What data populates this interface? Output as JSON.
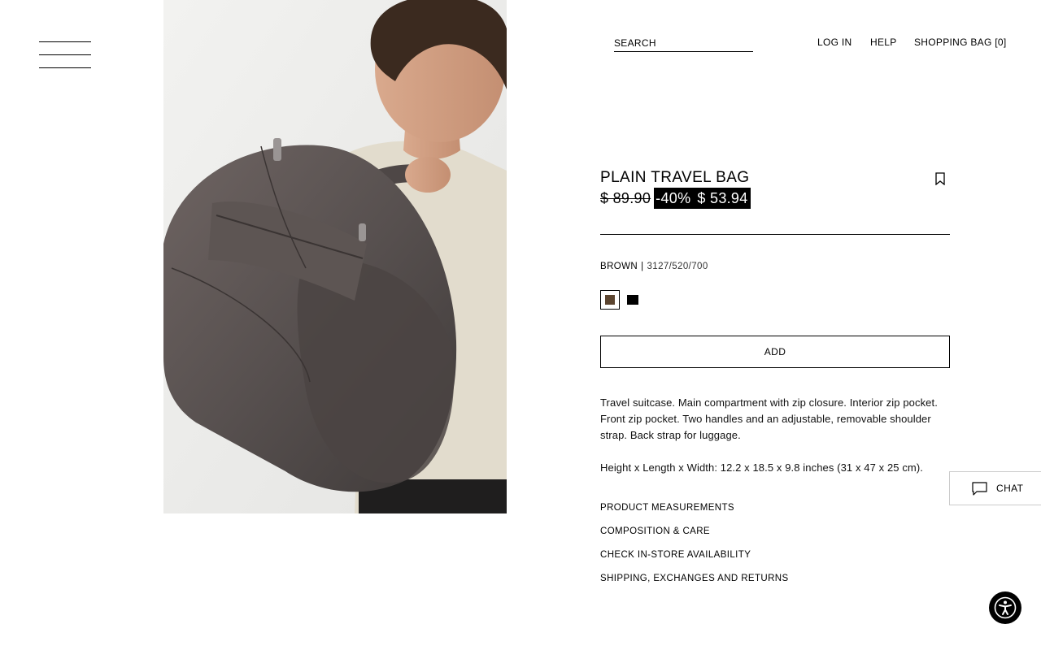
{
  "header": {
    "search_placeholder": "SEARCH",
    "login_label": "LOG IN",
    "help_label": "HELP",
    "bag_label": "SHOPPING BAG [0]"
  },
  "product": {
    "title": "PLAIN TRAVEL BAG",
    "old_price": "$ 89.90",
    "discount": "-40%",
    "new_price": "$ 53.94",
    "color_name": "BROWN",
    "color_separator": "|",
    "reference": "3127/520/700",
    "colors": [
      {
        "name": "brown",
        "hex": "#5c4530",
        "selected": true
      },
      {
        "name": "black",
        "hex": "#000000",
        "selected": false
      }
    ],
    "add_label": "ADD",
    "description": "Travel suitcase. Main compartment with zip closure. Interior zip pocket. Front zip pocket. Two handles and an adjustable, removable shoulder strap. Back strap for luggage.",
    "dimensions": "Height x Length x Width: 12.2 x 18.5 x 9.8 inches (31 x 47 x 25 cm).",
    "info_links": [
      "PRODUCT MEASUREMENTS",
      "COMPOSITION & CARE",
      "CHECK IN-STORE AVAILABILITY",
      "SHIPPING, EXCHANGES AND RETURNS"
    ]
  },
  "chat": {
    "label": "CHAT"
  },
  "icons": {
    "menu": "hamburger-menu-icon",
    "bookmark": "bookmark-icon",
    "chat": "chat-bubble-icon",
    "accessibility": "accessibility-icon"
  },
  "colors": {
    "sale_background": "#000000",
    "sale_text": "#ffffff"
  }
}
